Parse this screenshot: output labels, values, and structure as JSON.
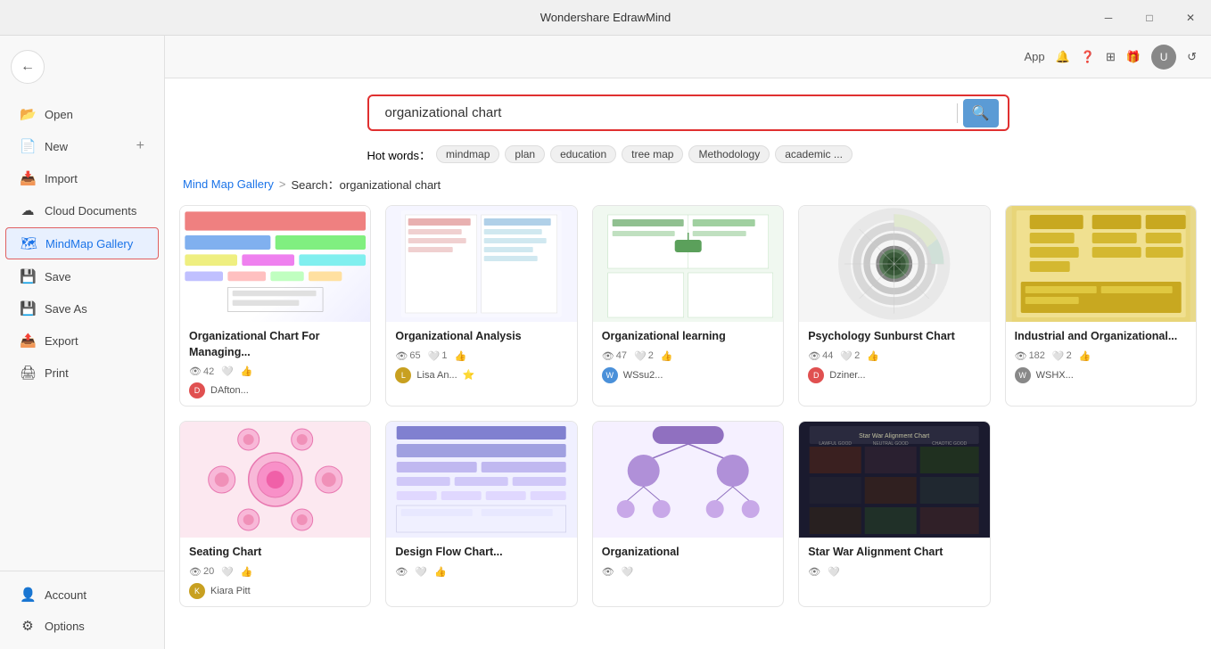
{
  "app": {
    "title": "Wondershare EdrawMind",
    "window_controls": [
      "minimize",
      "maximize",
      "close"
    ]
  },
  "titlebar": {
    "title": "Wondershare EdrawMind"
  },
  "topbar": {
    "app_label": "App",
    "refresh_icon": "↺"
  },
  "sidebar": {
    "items": [
      {
        "id": "open",
        "label": "Open",
        "icon": "📂"
      },
      {
        "id": "new",
        "label": "New",
        "icon": "📄"
      },
      {
        "id": "import",
        "label": "Import",
        "icon": "📥"
      },
      {
        "id": "cloud-documents",
        "label": "Cloud Documents",
        "icon": "☁"
      },
      {
        "id": "mindmap-gallery",
        "label": "MindMap Gallery",
        "icon": "🗺",
        "active": true
      },
      {
        "id": "save",
        "label": "Save",
        "icon": "💾"
      },
      {
        "id": "save-as",
        "label": "Save As",
        "icon": "💾"
      },
      {
        "id": "export",
        "label": "Export",
        "icon": "📤"
      },
      {
        "id": "print",
        "label": "Print",
        "icon": "🖨"
      }
    ],
    "bottom_items": [
      {
        "id": "account",
        "label": "Account",
        "icon": "👤"
      },
      {
        "id": "options",
        "label": "Options",
        "icon": "⚙"
      }
    ]
  },
  "search": {
    "value": "organizational chart",
    "placeholder": "organizational chart",
    "button_icon": "🔍"
  },
  "hot_words": {
    "label": "Hot words：",
    "items": [
      "mindmap",
      "plan",
      "education",
      "tree map",
      "Methodology",
      "academic ..."
    ]
  },
  "breadcrumb": {
    "root": "Mind Map Gallery",
    "separator": ">",
    "current": "Search：organizational chart"
  },
  "gallery": {
    "cards": [
      {
        "id": "org1",
        "title": "Organizational Chart For Managing...",
        "views": 42,
        "likes": 0,
        "thumbs_up": 0,
        "author": "DAfton...",
        "author_color": "#e05050",
        "thumb_type": "org1"
      },
      {
        "id": "org2",
        "title": "Organizational Analysis",
        "views": 65,
        "likes": 1,
        "thumbs_up": 0,
        "author": "Lisa An...",
        "author_color": "#c8a020",
        "badge": "⭐",
        "thumb_type": "org2"
      },
      {
        "id": "org3",
        "title": "Organizational learning",
        "views": 47,
        "likes": 2,
        "thumbs_up": 0,
        "author": "WSsu2...",
        "author_color": "#4a90d9",
        "thumb_type": "org3"
      },
      {
        "id": "sunburst",
        "title": "Psychology Sunburst Chart",
        "views": 44,
        "likes": 2,
        "thumbs_up": 0,
        "author": "Dziner...",
        "author_color": "#e05050",
        "thumb_type": "sunburst"
      },
      {
        "id": "ind",
        "title": "Industrial and Organizational...",
        "views": 182,
        "likes": 2,
        "thumbs_up": 0,
        "author": "WSHX...",
        "author_color": "#888",
        "thumb_type": "ind"
      },
      {
        "id": "seat",
        "title": "Seating Chart",
        "views": 20,
        "likes": 0,
        "thumbs_up": 0,
        "author": "Kiara Pitt",
        "author_color": "#c8a020",
        "thumb_type": "seat"
      },
      {
        "id": "flow",
        "title": "Design Flow Chart...",
        "views": 0,
        "likes": 0,
        "thumbs_up": 0,
        "author": "",
        "author_color": "#888",
        "thumb_type": "flow"
      },
      {
        "id": "org4",
        "title": "Organizational",
        "views": 0,
        "likes": 0,
        "thumbs_up": 0,
        "author": "",
        "author_color": "#888",
        "thumb_type": "org4"
      },
      {
        "id": "star",
        "title": "Star War Alignment Chart",
        "views": 0,
        "likes": 0,
        "thumbs_up": 0,
        "author": "",
        "author_color": "#888",
        "thumb_type": "star"
      }
    ]
  }
}
